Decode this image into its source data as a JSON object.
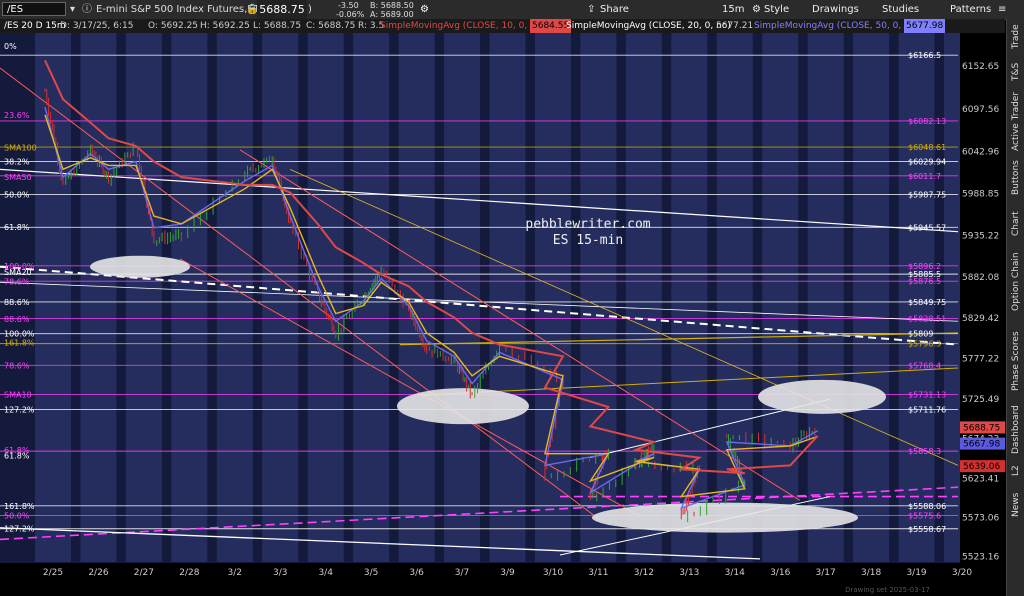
{
  "toolbar": {
    "symbol": "/ES",
    "instrument": "E-mini S&P 500 Index Futures,ETH (JUN 25)",
    "last_price": "5688.75",
    "change": "-3.50",
    "change_pct": "-0.06%",
    "bid": "B: 5688.50",
    "ask": "A: 5689.00",
    "buttons": {
      "share": "Share",
      "interval": "15m",
      "style": "Style",
      "drawings": "Drawings",
      "studies": "Studies",
      "patterns": "Patterns"
    }
  },
  "infobar": {
    "title": "/ES 20 D 15m",
    "date": "D: 3/17/25, 6:15",
    "open": "O: 5692.25",
    "high": "H: 5692.25",
    "low": "L: 5688.75",
    "close": "C: 5688.75",
    "range": "R: 3.5",
    "sma10_label": "SimpleMovingAvg (CLOSE, 10, 0, no)",
    "sma10_value": "5684.55",
    "sma20_label": "SimpleMovingAvg (CLOSE, 20, 0, no)",
    "sma20_value": "5677.21",
    "sma50_label": "SimpleMovingAvg (CLOSE, 50, 0, no)",
    "sma50_value": "5677.98"
  },
  "side_tabs": [
    "Trade",
    "T&S",
    "Active Trader",
    "Buttons",
    "Chart",
    "Option Chain",
    "Phase Scores",
    "Dashboard",
    "L2",
    "News"
  ],
  "colors": {
    "bg": "#000000",
    "session_dark": "#141a3c",
    "session_light": "#2a3468",
    "candle_up": "#2fa82f",
    "candle_down": "#d43030",
    "sma10": "#6a6af0",
    "sma20": "#e6b820",
    "sma50": "#e04848",
    "fib": "#ff40ff",
    "white": "#ffffff",
    "yellow": "#d4b000"
  },
  "chart_data": {
    "type": "candlestick",
    "watermark": [
      "pebblewriter.com",
      "ES 15-min"
    ],
    "ylim": [
      5516,
      6195
    ],
    "x_ticks": [
      "2/25",
      "2/26",
      "2/27",
      "2/28",
      "3/2",
      "3/3",
      "3/4",
      "3/5",
      "3/6",
      "3/7",
      "3/9",
      "3/10",
      "3/11",
      "3/12",
      "3/13",
      "3/14",
      "3/16",
      "3/17",
      "3/18",
      "3/19",
      "3/20"
    ],
    "y_ticks": [
      6152.65,
      6097.56,
      6042.96,
      5988.85,
      5935.22,
      5882.08,
      5829.42,
      5777.22,
      5725.49,
      5674.23,
      5623.41,
      5573.06,
      5523.16
    ],
    "last_price": 5688.75,
    "path": [
      {
        "x": "2/25",
        "y": 6120
      },
      {
        "x": "2/25",
        "y": 6000
      },
      {
        "x": "2/26",
        "y": 6045
      },
      {
        "x": "2/26",
        "y": 6010
      },
      {
        "x": "2/27",
        "y": 6050
      },
      {
        "x": "2/27",
        "y": 5930
      },
      {
        "x": "2/28",
        "y": 5935
      },
      {
        "x": "3/2",
        "y": 6015
      },
      {
        "x": "3/3",
        "y": 6035
      },
      {
        "x": "3/3",
        "y": 5950
      },
      {
        "x": "3/4",
        "y": 5860
      },
      {
        "x": "3/4",
        "y": 5810
      },
      {
        "x": "3/5",
        "y": 5855
      },
      {
        "x": "3/5",
        "y": 5890
      },
      {
        "x": "3/6",
        "y": 5840
      },
      {
        "x": "3/6",
        "y": 5790
      },
      {
        "x": "3/7",
        "y": 5775
      },
      {
        "x": "3/7",
        "y": 5730
      },
      {
        "x": "3/9",
        "y": 5795
      },
      {
        "x": "3/10",
        "y": 5745
      },
      {
        "x": "3/10",
        "y": 5625
      },
      {
        "x": "3/11",
        "y": 5660
      },
      {
        "x": "3/11",
        "y": 5595
      },
      {
        "x": "3/12",
        "y": 5665
      },
      {
        "x": "3/12",
        "y": 5640
      },
      {
        "x": "3/13",
        "y": 5635
      },
      {
        "x": "3/13",
        "y": 5570
      },
      {
        "x": "3/14",
        "y": 5620
      },
      {
        "x": "3/14",
        "y": 5680
      },
      {
        "x": "3/16",
        "y": 5665
      },
      {
        "x": "3/17",
        "y": 5690
      }
    ],
    "sma_series": [
      {
        "name": "SMA10",
        "color": "#6a6af0",
        "values": [
          6100,
          6010,
          6040,
          6020,
          6030,
          5945,
          5950,
          6005,
          6025,
          5960,
          5870,
          5825,
          5850,
          5880,
          5845,
          5800,
          5780,
          5745,
          5785,
          5750,
          5640,
          5655,
          5605,
          5655,
          5645,
          5635,
          5585,
          5615,
          5670,
          5665,
          5684.55
        ]
      },
      {
        "name": "SMA20",
        "color": "#e6b820",
        "values": [
          6090,
          6020,
          6035,
          6025,
          6025,
          5960,
          5950,
          5995,
          6020,
          5970,
          5885,
          5835,
          5845,
          5875,
          5850,
          5810,
          5785,
          5755,
          5780,
          5755,
          5655,
          5655,
          5620,
          5650,
          5645,
          5635,
          5600,
          5610,
          5660,
          5665,
          5677.21
        ]
      },
      {
        "name": "SMA50",
        "color": "#e04848",
        "values": [
          6160,
          6110,
          6080,
          6060,
          6050,
          6030,
          6010,
          6000,
          6000,
          5990,
          5950,
          5920,
          5900,
          5885,
          5870,
          5850,
          5830,
          5810,
          5795,
          5780,
          5740,
          5715,
          5690,
          5670,
          5660,
          5650,
          5635,
          5630,
          5635,
          5640,
          5677.98
        ]
      }
    ],
    "price_labels": [
      {
        "value": 6166.5,
        "text": "$6166.5",
        "color": "#ffffff"
      },
      {
        "value": 6082.13,
        "text": "$6082.13",
        "color": "#ff40ff"
      },
      {
        "value": 6048.61,
        "text": "$6048.61",
        "color": "#d4b000"
      },
      {
        "value": 6029.94,
        "text": "$6029.94",
        "color": "#ffffff"
      },
      {
        "value": 6011.7,
        "text": "$6011.7",
        "color": "#ff40ff"
      },
      {
        "value": 5987.75,
        "text": "$5987.75",
        "color": "#ffffff"
      },
      {
        "value": 5945.57,
        "text": "$5945.57",
        "color": "#ffffff"
      },
      {
        "value": 5896.2,
        "text": "$5896.2",
        "color": "#ff40ff"
      },
      {
        "value": 5885.5,
        "text": "$5885.5",
        "color": "#ffffff"
      },
      {
        "value": 5876.5,
        "text": "$5876.5",
        "color": "#ff40ff"
      },
      {
        "value": 5849.75,
        "text": "$5849.75",
        "color": "#ffffff"
      },
      {
        "value": 5828.51,
        "text": "$5828.51",
        "color": "#ff40ff"
      },
      {
        "value": 5809,
        "text": "$5809",
        "color": "#ffffff"
      },
      {
        "value": 5796.3,
        "text": "$5796.3",
        "color": "#d4b000"
      },
      {
        "value": 5768.4,
        "text": "$5768.4",
        "color": "#ff40ff"
      },
      {
        "value": 5731.13,
        "text": "$5731.13",
        "color": "#ff40ff"
      },
      {
        "value": 5711.76,
        "text": "$5711.76",
        "color": "#ffffff"
      },
      {
        "value": 5658.3,
        "text": "$5658.3",
        "color": "#ff40ff"
      },
      {
        "value": 5588.06,
        "text": "$5588.06",
        "color": "#ffffff"
      },
      {
        "value": 5575.6,
        "text": "$5575.6",
        "color": "#ff40ff"
      },
      {
        "value": 5558.67,
        "text": "$5558.67",
        "color": "#ffffff"
      }
    ],
    "axis_tags": [
      {
        "value": 5688.75,
        "text": "5688.75",
        "bg": "#e04848"
      },
      {
        "value": 5667.98,
        "text": "5667.98",
        "bg": "#5a5ae0"
      },
      {
        "value": 5639.06,
        "text": "5639.06",
        "bg": "#d43030"
      }
    ],
    "left_labels": [
      {
        "value": 6178,
        "text": "0%",
        "color": "#ffffff"
      },
      {
        "value": 6090,
        "text": "23.6%",
        "color": "#ff40ff"
      },
      {
        "value": 6048,
        "text": "SMA100",
        "color": "#d4b000"
      },
      {
        "value": 6030,
        "text": "38.2%",
        "color": "#ffffff"
      },
      {
        "value": 6010,
        "text": "SMA50",
        "color": "#ff40ff"
      },
      {
        "value": 5988,
        "text": "50.0%",
        "color": "#ffffff"
      },
      {
        "value": 5946,
        "text": "61.8%",
        "color": "#ffffff"
      },
      {
        "value": 5896,
        "text": "100.0%",
        "color": "#ff40ff"
      },
      {
        "value": 5888,
        "text": "SMA20",
        "color": "#ffffff"
      },
      {
        "value": 5876,
        "text": "78.6%",
        "color": "#ff40ff"
      },
      {
        "value": 5850,
        "text": "88.6%",
        "color": "#ffffff"
      },
      {
        "value": 5828,
        "text": "88.6%",
        "color": "#ff40ff"
      },
      {
        "value": 5809,
        "text": "100.0%",
        "color": "#ffffff"
      },
      {
        "value": 5798,
        "text": "161.8%",
        "color": "#d4b000"
      },
      {
        "value": 5768,
        "text": "78.6%",
        "color": "#ff40ff"
      },
      {
        "value": 5731,
        "text": "SMA10",
        "color": "#ff40ff"
      },
      {
        "value": 5712,
        "text": "127.2%",
        "color": "#ffffff"
      },
      {
        "value": 5660,
        "text": "61.8%",
        "color": "#ff40ff"
      },
      {
        "value": 5653,
        "text": "61.8%",
        "color": "#ffffff"
      },
      {
        "value": 5588,
        "text": "161.8%",
        "color": "#ffffff"
      },
      {
        "value": 5576,
        "text": "50.0%",
        "color": "#ff40ff"
      },
      {
        "value": 5559,
        "text": "127.2%",
        "color": "#ffffff"
      }
    ],
    "footer": "Drawing set 2025-03-17"
  }
}
